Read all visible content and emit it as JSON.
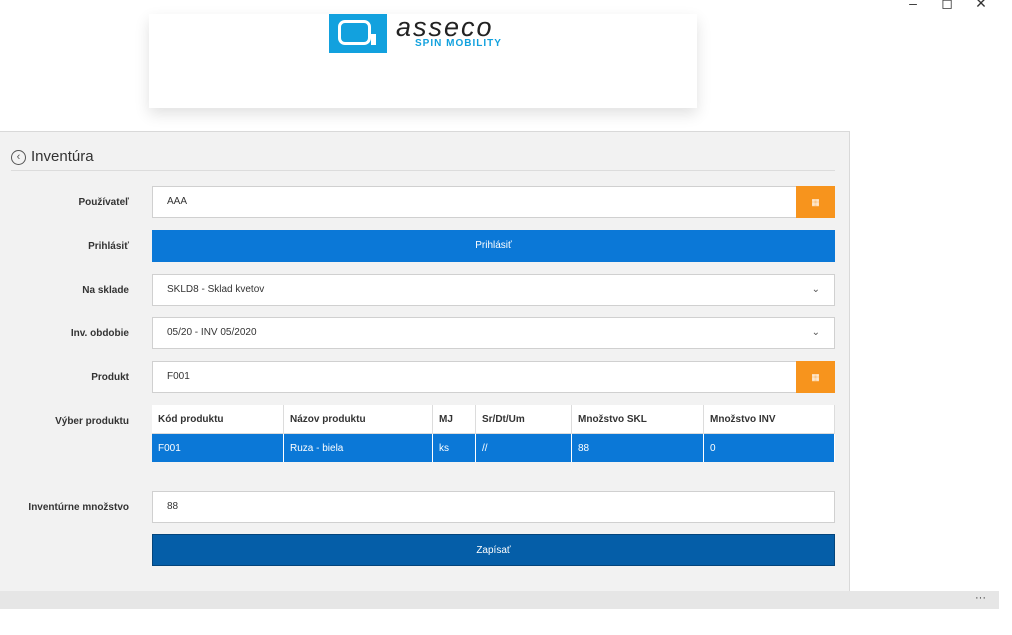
{
  "window": {
    "minimize": "–",
    "maximize": "◻",
    "close": "✕"
  },
  "logo": {
    "word": "asseco",
    "sub": "SPIN MOBILITY"
  },
  "header": {
    "back_icon": "‹",
    "title": "Inventúra"
  },
  "form": {
    "user_label": "Používateľ",
    "user_value": "AAA",
    "login_label": "Prihlásiť",
    "login_button": "Prihlásiť",
    "warehouse_label": "Na sklade",
    "warehouse_value": "SKLD8 - Sklad kvetov",
    "period_label": "Inv. obdobie",
    "period_value": "05/20 - INV 05/2020",
    "product_label": "Produkt",
    "product_value": "F001",
    "selection_label": "Výber produktu",
    "qty_label": "Inventúrne množstvo",
    "qty_value": "88",
    "save_button": "Zapísať",
    "qr_icon": "▦"
  },
  "table": {
    "columns": [
      "Kód produktu",
      "Názov produktu",
      "MJ",
      "Sr/Dt/Um",
      "Množstvo SKL",
      "Množstvo INV"
    ],
    "rows": [
      [
        "F001",
        "Ruza - biela",
        "ks",
        "//",
        "88",
        "0"
      ]
    ]
  },
  "status": {
    "more": "···"
  },
  "colors": {
    "accent_blue": "#0b78d7",
    "dark_blue": "#055ea8",
    "orange": "#f7941d",
    "brand": "#12a1de"
  }
}
